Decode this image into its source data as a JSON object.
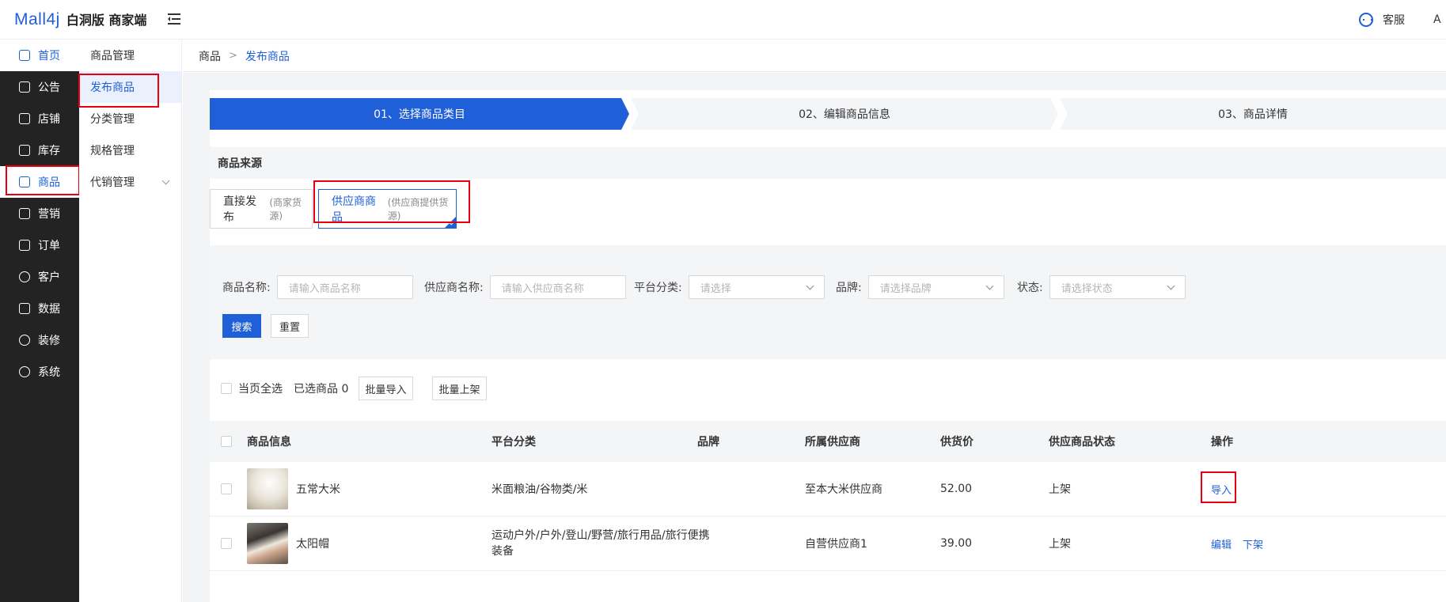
{
  "header": {
    "brand": "Mall4j",
    "edition": "白洞版 商家端",
    "service_label": "客服",
    "user_initial": "A",
    "accent_color": "#1f5fd8"
  },
  "sidebar": {
    "items": [
      {
        "label": "首页",
        "icon": "home-icon"
      },
      {
        "label": "公告",
        "icon": "notice-icon"
      },
      {
        "label": "店铺",
        "icon": "shop-icon"
      },
      {
        "label": "库存",
        "icon": "inventory-icon"
      },
      {
        "label": "商品",
        "icon": "product-icon"
      },
      {
        "label": "营销",
        "icon": "gift-icon"
      },
      {
        "label": "订单",
        "icon": "order-icon"
      },
      {
        "label": "客户",
        "icon": "user-icon"
      },
      {
        "label": "数据",
        "icon": "chart-icon"
      },
      {
        "label": "装修",
        "icon": "decorate-icon"
      },
      {
        "label": "系统",
        "icon": "gear-icon"
      }
    ]
  },
  "subnav": {
    "items": [
      {
        "label": "商品管理"
      },
      {
        "label": "发布商品"
      },
      {
        "label": "分类管理"
      },
      {
        "label": "规格管理"
      },
      {
        "label": "代销管理"
      }
    ]
  },
  "breadcrumb": {
    "parent": "商品",
    "sep": ">",
    "current": "发布商品"
  },
  "steps": [
    "01、选择商品类目",
    "02、编辑商品信息",
    "03、商品详情"
  ],
  "source": {
    "title": "商品来源",
    "direct": {
      "label": "直接发布",
      "hint": "(商家货源)"
    },
    "supplier": {
      "label": "供应商商品",
      "hint": "(供应商提供货源)"
    }
  },
  "filters": {
    "name_label": "商品名称:",
    "name_placeholder": "请输入商品名称",
    "supplier_label": "供应商名称:",
    "supplier_placeholder": "请输入供应商名称",
    "category_label": "平台分类:",
    "category_placeholder": "请选择",
    "brand_label": "品牌:",
    "brand_placeholder": "请选择品牌",
    "status_label": "状态:",
    "status_placeholder": "请选择状态",
    "search_button": "搜索",
    "reset_button": "重置"
  },
  "batch": {
    "select_all": "当页全选",
    "selected_text": "已选商品 0",
    "import_button": "批量导入",
    "shelf_button": "批量上架"
  },
  "table": {
    "columns": [
      "商品信息",
      "平台分类",
      "品牌",
      "所属供应商",
      "供货价",
      "供应商品状态",
      "操作"
    ],
    "rows": [
      {
        "name": "五常大米",
        "category": "米面粮油/谷物类/米",
        "brand": "",
        "supplier": "至本大米供应商",
        "price": "52.00",
        "status": "上架",
        "actions": [
          "导入"
        ],
        "image": "rice"
      },
      {
        "name": "太阳帽",
        "category_line1": "运动户外/户外/登山/野营/旅行用品/旅行便携",
        "category_line2": "装备",
        "brand": "",
        "supplier": "自营供应商1",
        "price": "39.00",
        "status": "上架",
        "actions": [
          "编辑",
          "下架"
        ],
        "image": "hat"
      }
    ]
  }
}
